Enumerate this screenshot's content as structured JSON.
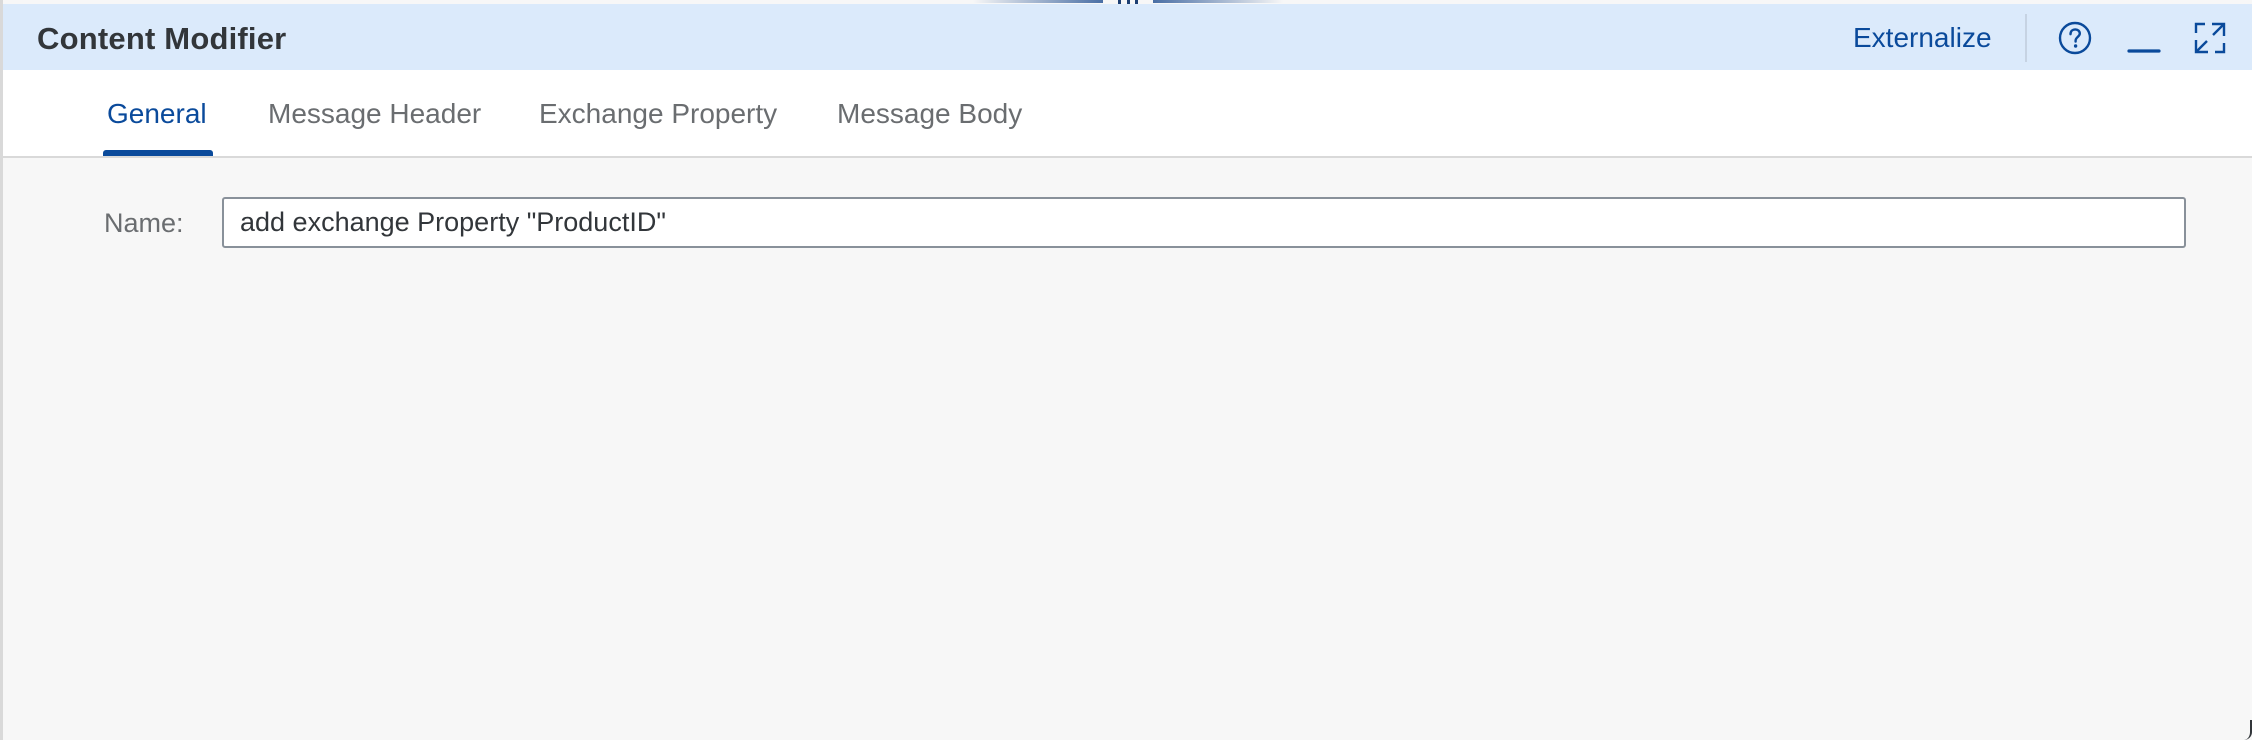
{
  "header": {
    "title": "Content Modifier",
    "externalize_label": "Externalize",
    "help_icon": "help-circle-icon",
    "minimize_icon": "minimize-icon",
    "maximize_icon": "maximize-icon"
  },
  "tabs": [
    {
      "label": "General",
      "active": true
    },
    {
      "label": "Message Header",
      "active": false
    },
    {
      "label": "Exchange Property",
      "active": false
    },
    {
      "label": "Message Body",
      "active": false
    }
  ],
  "form": {
    "name_label": "Name:",
    "name_value": "add exchange Property \"ProductID\""
  },
  "colors": {
    "header_bg": "#dbeafb",
    "accent": "#0a4a9b",
    "panel_bg": "#f7f7f7"
  }
}
